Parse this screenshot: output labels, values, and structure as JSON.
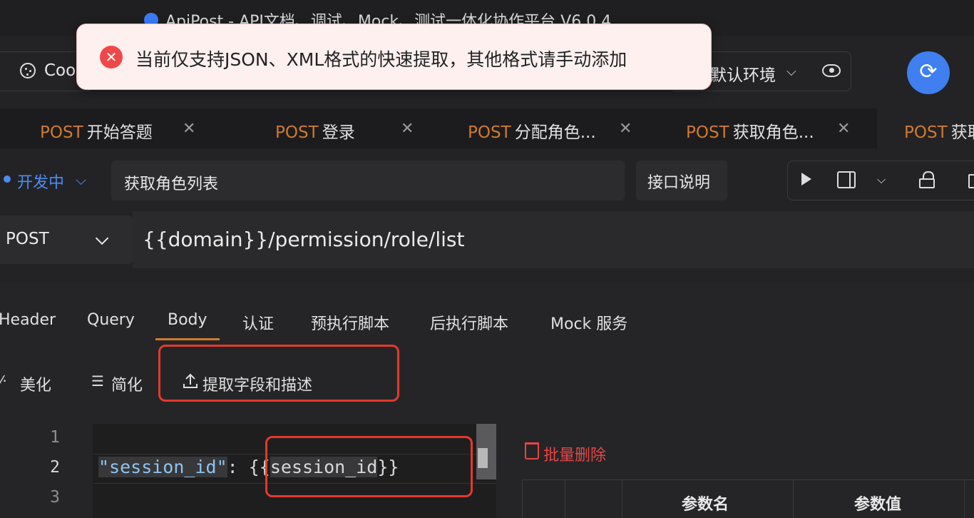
{
  "window": {
    "title": "ApiPost - API文档、调试、Mock、测试一体化协作平台 V6.0.4"
  },
  "toast": {
    "icon": "error-circle-icon",
    "message": "当前仅支持JSON、XML格式的快速提取，其他格式请手动添加",
    "accent": "#f04848"
  },
  "env_bar": {
    "cookie_label": "Coo",
    "env_label": "默认环境"
  },
  "tabs": [
    {
      "method": "POST",
      "name": "开始答题"
    },
    {
      "method": "POST",
      "name": "登录"
    },
    {
      "method": "POST",
      "name": "分配角色..."
    },
    {
      "method": "POST",
      "name": "获取角色..."
    },
    {
      "method": "POST",
      "name": "获取"
    }
  ],
  "status": {
    "label": "开发中",
    "color": "#4b8cf0"
  },
  "api": {
    "name": "获取角色列表",
    "doc_button": "接口说明",
    "method": "POST",
    "url": "{{domain}}/permission/role/list"
  },
  "request_tabs": [
    "Header",
    "Query",
    "Body",
    "认证",
    "预执行脚本",
    "后执行脚本",
    "Mock 服务"
  ],
  "active_request_tab": "Body",
  "body_toolbar": {
    "beautify": "美化",
    "simplify": "简化",
    "extract": "提取字段和描述"
  },
  "editor": {
    "line_numbers": [
      "1",
      "2",
      "3"
    ],
    "code_key": "\"session_id\"",
    "code_colon": ": ",
    "code_value_open": "{{",
    "code_value_inner": "session_id",
    "code_value_close": "}}"
  },
  "params": {
    "bulk_delete": "批量删除",
    "columns": [
      "参数名",
      "参数值"
    ]
  },
  "colors": {
    "method": "#d07a2e",
    "highlight_box": "#e33a2c",
    "delete": "#e64545",
    "sync_button": "#3f7ff0"
  }
}
